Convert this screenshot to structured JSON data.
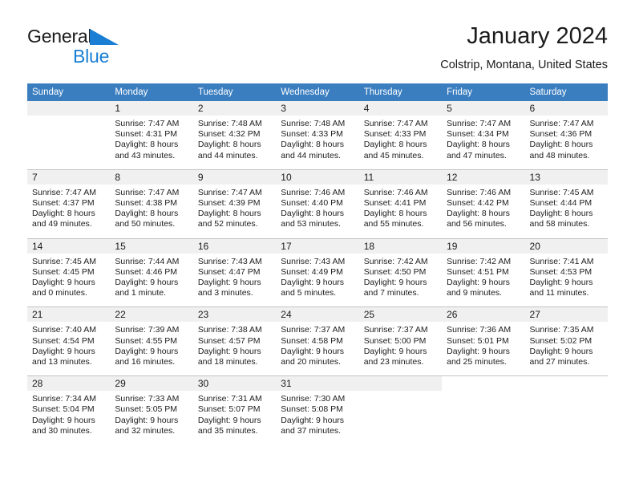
{
  "brand": {
    "name_part1": "General",
    "name_part2": "Blue",
    "triangle_color": "#1a7fd4"
  },
  "header": {
    "title": "January 2024",
    "subtitle": "Colstrip, Montana, United States"
  },
  "theme": {
    "header_bg": "#3b7ec0",
    "daynum_bg": "#f0f0f0",
    "grid_line": "#c4c4c4",
    "accent": "#2b6ca8"
  },
  "weekday_headers": [
    "Sunday",
    "Monday",
    "Tuesday",
    "Wednesday",
    "Thursday",
    "Friday",
    "Saturday"
  ],
  "labels": {
    "sunrise_prefix": "Sunrise: ",
    "sunset_prefix": "Sunset: ",
    "daylight_prefix": "Daylight: "
  },
  "weeks": [
    [
      {
        "day": "",
        "sunrise": "",
        "sunset": "",
        "daylight": "",
        "blank": true
      },
      {
        "day": "1",
        "sunrise": "Sunrise: 7:47 AM",
        "sunset": "Sunset: 4:31 PM",
        "daylight": "Daylight: 8 hours and 43 minutes."
      },
      {
        "day": "2",
        "sunrise": "Sunrise: 7:48 AM",
        "sunset": "Sunset: 4:32 PM",
        "daylight": "Daylight: 8 hours and 44 minutes."
      },
      {
        "day": "3",
        "sunrise": "Sunrise: 7:48 AM",
        "sunset": "Sunset: 4:33 PM",
        "daylight": "Daylight: 8 hours and 44 minutes."
      },
      {
        "day": "4",
        "sunrise": "Sunrise: 7:47 AM",
        "sunset": "Sunset: 4:33 PM",
        "daylight": "Daylight: 8 hours and 45 minutes."
      },
      {
        "day": "5",
        "sunrise": "Sunrise: 7:47 AM",
        "sunset": "Sunset: 4:34 PM",
        "daylight": "Daylight: 8 hours and 47 minutes."
      },
      {
        "day": "6",
        "sunrise": "Sunrise: 7:47 AM",
        "sunset": "Sunset: 4:36 PM",
        "daylight": "Daylight: 8 hours and 48 minutes."
      }
    ],
    [
      {
        "day": "7",
        "sunrise": "Sunrise: 7:47 AM",
        "sunset": "Sunset: 4:37 PM",
        "daylight": "Daylight: 8 hours and 49 minutes."
      },
      {
        "day": "8",
        "sunrise": "Sunrise: 7:47 AM",
        "sunset": "Sunset: 4:38 PM",
        "daylight": "Daylight: 8 hours and 50 minutes."
      },
      {
        "day": "9",
        "sunrise": "Sunrise: 7:47 AM",
        "sunset": "Sunset: 4:39 PM",
        "daylight": "Daylight: 8 hours and 52 minutes."
      },
      {
        "day": "10",
        "sunrise": "Sunrise: 7:46 AM",
        "sunset": "Sunset: 4:40 PM",
        "daylight": "Daylight: 8 hours and 53 minutes."
      },
      {
        "day": "11",
        "sunrise": "Sunrise: 7:46 AM",
        "sunset": "Sunset: 4:41 PM",
        "daylight": "Daylight: 8 hours and 55 minutes."
      },
      {
        "day": "12",
        "sunrise": "Sunrise: 7:46 AM",
        "sunset": "Sunset: 4:42 PM",
        "daylight": "Daylight: 8 hours and 56 minutes."
      },
      {
        "day": "13",
        "sunrise": "Sunrise: 7:45 AM",
        "sunset": "Sunset: 4:44 PM",
        "daylight": "Daylight: 8 hours and 58 minutes."
      }
    ],
    [
      {
        "day": "14",
        "sunrise": "Sunrise: 7:45 AM",
        "sunset": "Sunset: 4:45 PM",
        "daylight": "Daylight: 9 hours and 0 minutes."
      },
      {
        "day": "15",
        "sunrise": "Sunrise: 7:44 AM",
        "sunset": "Sunset: 4:46 PM",
        "daylight": "Daylight: 9 hours and 1 minute."
      },
      {
        "day": "16",
        "sunrise": "Sunrise: 7:43 AM",
        "sunset": "Sunset: 4:47 PM",
        "daylight": "Daylight: 9 hours and 3 minutes."
      },
      {
        "day": "17",
        "sunrise": "Sunrise: 7:43 AM",
        "sunset": "Sunset: 4:49 PM",
        "daylight": "Daylight: 9 hours and 5 minutes."
      },
      {
        "day": "18",
        "sunrise": "Sunrise: 7:42 AM",
        "sunset": "Sunset: 4:50 PM",
        "daylight": "Daylight: 9 hours and 7 minutes."
      },
      {
        "day": "19",
        "sunrise": "Sunrise: 7:42 AM",
        "sunset": "Sunset: 4:51 PM",
        "daylight": "Daylight: 9 hours and 9 minutes."
      },
      {
        "day": "20",
        "sunrise": "Sunrise: 7:41 AM",
        "sunset": "Sunset: 4:53 PM",
        "daylight": "Daylight: 9 hours and 11 minutes."
      }
    ],
    [
      {
        "day": "21",
        "sunrise": "Sunrise: 7:40 AM",
        "sunset": "Sunset: 4:54 PM",
        "daylight": "Daylight: 9 hours and 13 minutes."
      },
      {
        "day": "22",
        "sunrise": "Sunrise: 7:39 AM",
        "sunset": "Sunset: 4:55 PM",
        "daylight": "Daylight: 9 hours and 16 minutes."
      },
      {
        "day": "23",
        "sunrise": "Sunrise: 7:38 AM",
        "sunset": "Sunset: 4:57 PM",
        "daylight": "Daylight: 9 hours and 18 minutes."
      },
      {
        "day": "24",
        "sunrise": "Sunrise: 7:37 AM",
        "sunset": "Sunset: 4:58 PM",
        "daylight": "Daylight: 9 hours and 20 minutes."
      },
      {
        "day": "25",
        "sunrise": "Sunrise: 7:37 AM",
        "sunset": "Sunset: 5:00 PM",
        "daylight": "Daylight: 9 hours and 23 minutes."
      },
      {
        "day": "26",
        "sunrise": "Sunrise: 7:36 AM",
        "sunset": "Sunset: 5:01 PM",
        "daylight": "Daylight: 9 hours and 25 minutes."
      },
      {
        "day": "27",
        "sunrise": "Sunrise: 7:35 AM",
        "sunset": "Sunset: 5:02 PM",
        "daylight": "Daylight: 9 hours and 27 minutes."
      }
    ],
    [
      {
        "day": "28",
        "sunrise": "Sunrise: 7:34 AM",
        "sunset": "Sunset: 5:04 PM",
        "daylight": "Daylight: 9 hours and 30 minutes."
      },
      {
        "day": "29",
        "sunrise": "Sunrise: 7:33 AM",
        "sunset": "Sunset: 5:05 PM",
        "daylight": "Daylight: 9 hours and 32 minutes."
      },
      {
        "day": "30",
        "sunrise": "Sunrise: 7:31 AM",
        "sunset": "Sunset: 5:07 PM",
        "daylight": "Daylight: 9 hours and 35 minutes."
      },
      {
        "day": "31",
        "sunrise": "Sunrise: 7:30 AM",
        "sunset": "Sunset: 5:08 PM",
        "daylight": "Daylight: 9 hours and 37 minutes."
      },
      {
        "day": "",
        "sunrise": "",
        "sunset": "",
        "daylight": "",
        "blank": true
      },
      {
        "day": "",
        "sunrise": "",
        "sunset": "",
        "daylight": "",
        "void": true
      },
      {
        "day": "",
        "sunrise": "",
        "sunset": "",
        "daylight": "",
        "void": true
      }
    ]
  ]
}
